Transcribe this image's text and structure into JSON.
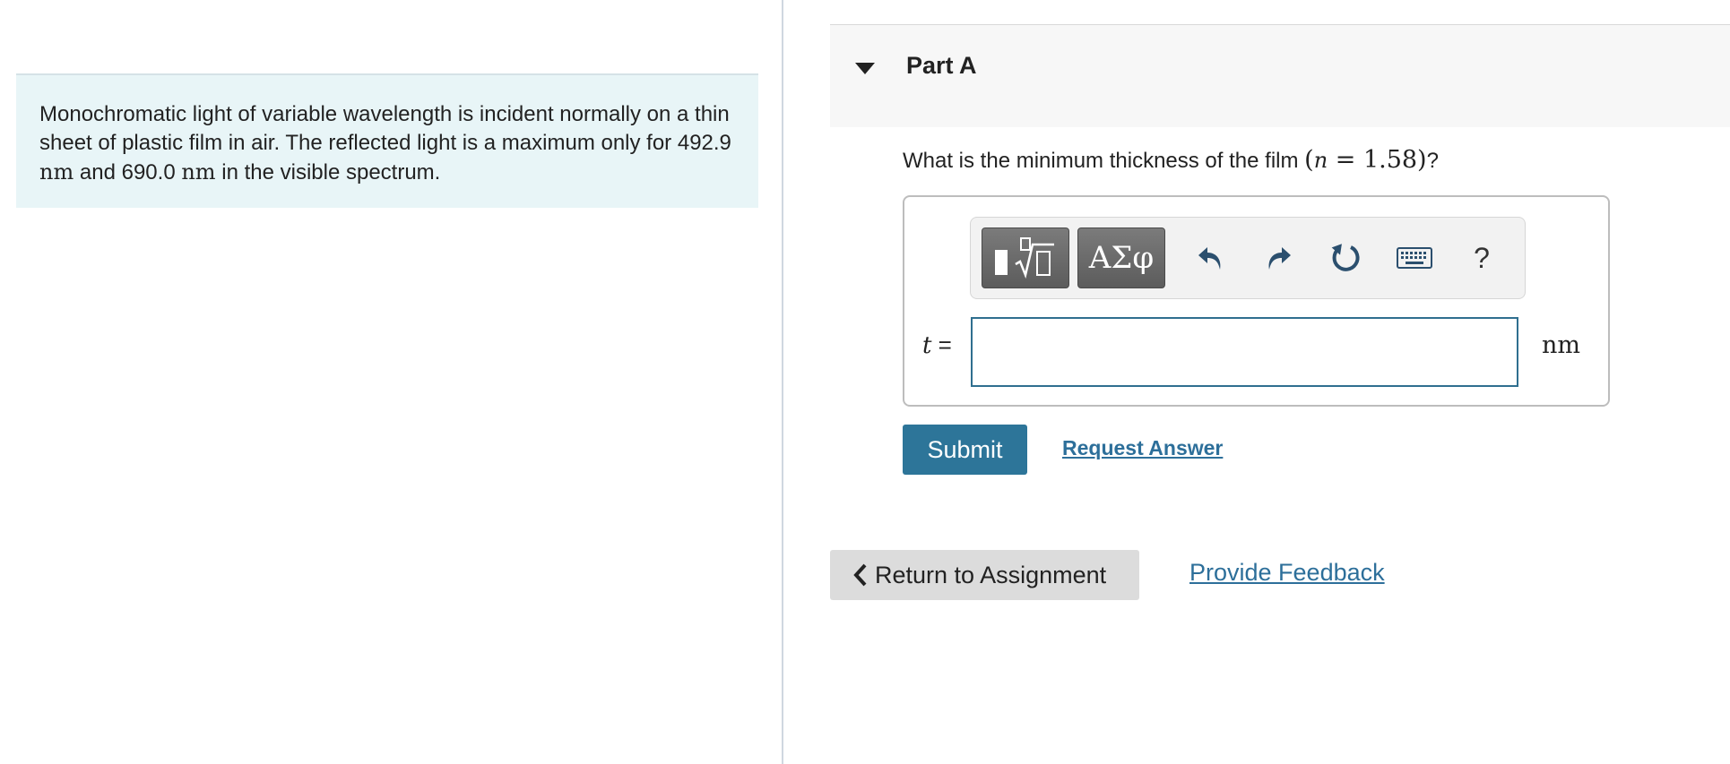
{
  "problem": {
    "text_1": "Monochromatic light of variable wavelength is incident normally on a thin sheet of plastic film in air. The reflected light is a maximum only for ",
    "value_1": "492.9",
    "unit_1": "nm",
    "text_2": " and ",
    "value_2": "690.0",
    "unit_2": "nm",
    "text_3": " in the visible spectrum."
  },
  "part": {
    "title": "Part A",
    "question_text": "What is the minimum thickness of the film ",
    "question_math_open": "(",
    "question_math_var": "n",
    "question_math_rest": " = 1.58)",
    "question_end": "?"
  },
  "toolbar": {
    "symbols_label": "ΑΣφ",
    "help_label": "?",
    "icons": [
      "templates-icon",
      "symbols-icon",
      "undo-icon",
      "redo-icon",
      "reset-icon",
      "keyboard-icon",
      "help-icon"
    ]
  },
  "answer": {
    "variable": "t",
    "equals": " =",
    "value": "",
    "unit": "nm"
  },
  "actions": {
    "submit_label": "Submit",
    "request_answer_label": "Request Answer",
    "return_label": "Return to Assignment",
    "feedback_label": "Provide Feedback"
  },
  "colors": {
    "accent": "#2d7599",
    "link": "#2d6f9a",
    "problem_bg": "#e8f5f7"
  }
}
